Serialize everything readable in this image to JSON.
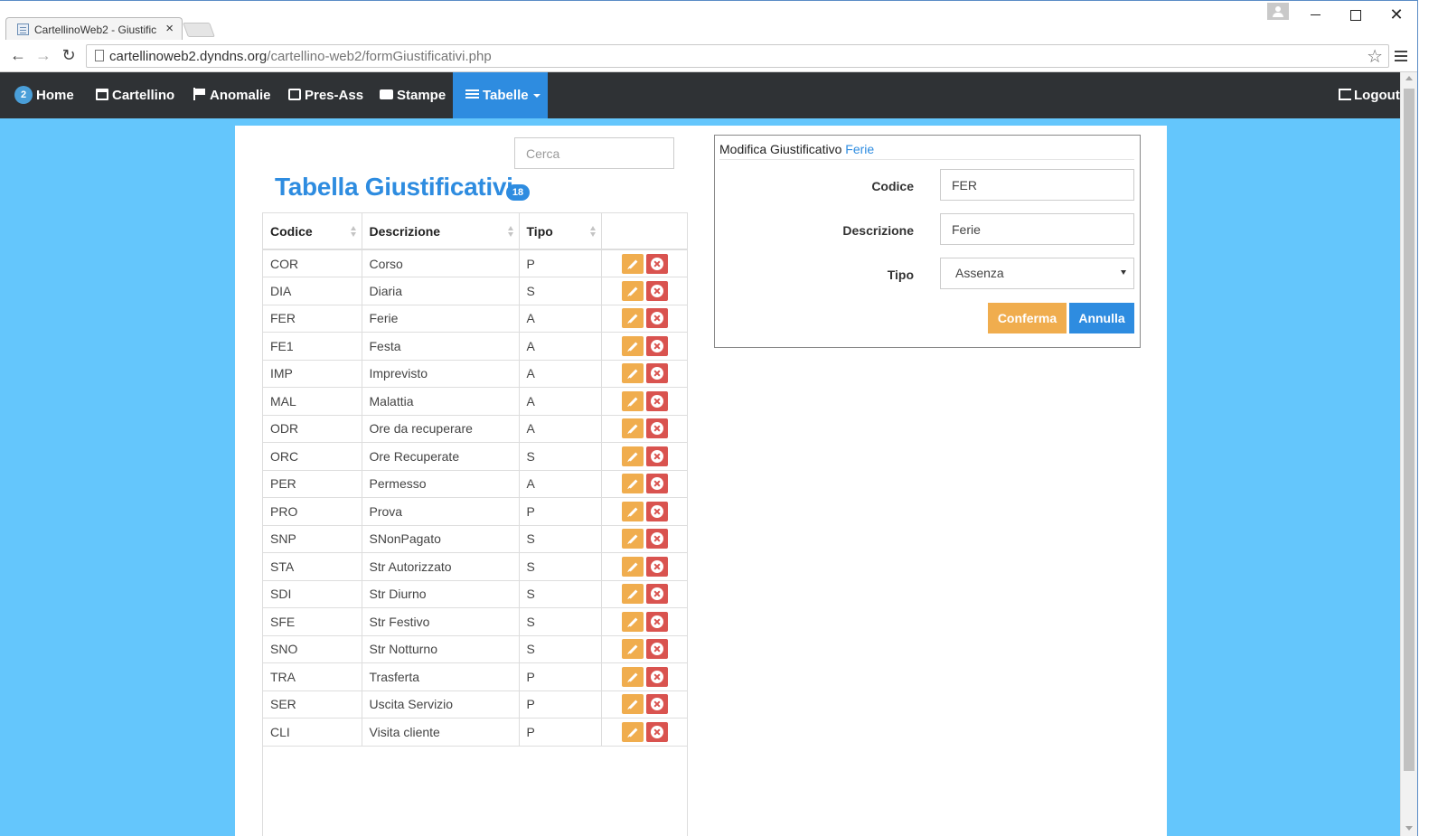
{
  "browser": {
    "tab_title": "CartellinoWeb2 - Giustific",
    "tab_close": "×",
    "win_close": "✕",
    "url_host": "cartellinoweb2.dyndns.org",
    "url_path": "/cartellino-web2/formGiustificativi.php",
    "back": "←",
    "forward": "→",
    "reload": "↻",
    "star": "☆"
  },
  "navbar": {
    "home_badge": "2",
    "home": "Home",
    "cartellino": "Cartellino",
    "anomalie": "Anomalie",
    "presass": "Pres-Ass",
    "stampe": "Stampe",
    "tabelle": "Tabelle",
    "logout": "Logout",
    "active_color": "#2e8ce0"
  },
  "search": {
    "placeholder": "Cerca"
  },
  "page": {
    "title": "Tabella Giustificativi",
    "count": "18",
    "background_color": "#64c6fc",
    "accent_color": "#2e8ce0"
  },
  "table": {
    "headers": {
      "codice": "Codice",
      "descrizione": "Descrizione",
      "tipo": "Tipo"
    },
    "rows": [
      {
        "codice": "COR",
        "descrizione": "Corso",
        "tipo": "P"
      },
      {
        "codice": "DIA",
        "descrizione": "Diaria",
        "tipo": "S"
      },
      {
        "codice": "FER",
        "descrizione": "Ferie",
        "tipo": "A"
      },
      {
        "codice": "FE1",
        "descrizione": "Festa",
        "tipo": "A"
      },
      {
        "codice": "IMP",
        "descrizione": "Imprevisto",
        "tipo": "A"
      },
      {
        "codice": "MAL",
        "descrizione": "Malattia",
        "tipo": "A"
      },
      {
        "codice": "ODR",
        "descrizione": "Ore da recuperare",
        "tipo": "A"
      },
      {
        "codice": "ORC",
        "descrizione": "Ore Recuperate",
        "tipo": "S"
      },
      {
        "codice": "PER",
        "descrizione": "Permesso",
        "tipo": "A"
      },
      {
        "codice": "PRO",
        "descrizione": "Prova",
        "tipo": "P"
      },
      {
        "codice": "SNP",
        "descrizione": "SNonPagato",
        "tipo": "S"
      },
      {
        "codice": "STA",
        "descrizione": "Str Autorizzato",
        "tipo": "S"
      },
      {
        "codice": "SDI",
        "descrizione": "Str Diurno",
        "tipo": "S"
      },
      {
        "codice": "SFE",
        "descrizione": "Str Festivo",
        "tipo": "S"
      },
      {
        "codice": "SNO",
        "descrizione": "Str Notturno",
        "tipo": "S"
      },
      {
        "codice": "TRA",
        "descrizione": "Trasferta",
        "tipo": "P"
      },
      {
        "codice": "SER",
        "descrizione": "Uscita Servizio",
        "tipo": "P"
      },
      {
        "codice": "CLI",
        "descrizione": "Visita cliente",
        "tipo": "P"
      }
    ],
    "edit_color": "#f0ad4e",
    "delete_color": "#d9534f"
  },
  "edit_panel": {
    "heading_prefix": "Modifica Giustificativo",
    "heading_item": "Ferie",
    "codice_label": "Codice",
    "codice_value": "FER",
    "descrizione_label": "Descrizione",
    "descrizione_value": "Ferie",
    "tipo_label": "Tipo",
    "tipo_value": "Assenza",
    "confirm_label": "Conferma",
    "cancel_label": "Annulla"
  }
}
